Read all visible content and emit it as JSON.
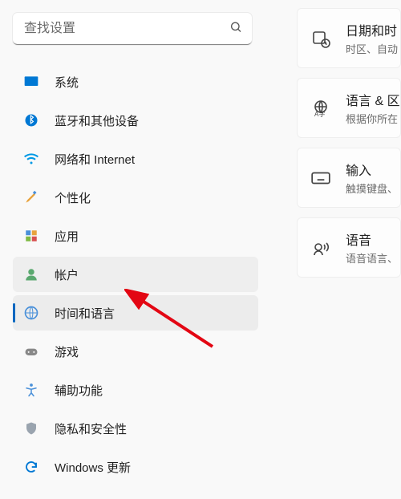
{
  "search": {
    "placeholder": "查找设置"
  },
  "sidebar": {
    "items": [
      {
        "label": "系统"
      },
      {
        "label": "蓝牙和其他设备"
      },
      {
        "label": "网络和 Internet"
      },
      {
        "label": "个性化"
      },
      {
        "label": "应用"
      },
      {
        "label": "帐户"
      },
      {
        "label": "时间和语言"
      },
      {
        "label": "游戏"
      },
      {
        "label": "辅助功能"
      },
      {
        "label": "隐私和安全性"
      },
      {
        "label": "Windows 更新"
      }
    ]
  },
  "cards": [
    {
      "title": "日期和时",
      "subtitle": "时区、自动"
    },
    {
      "title": "语言 & 区",
      "subtitle": "根据你所在"
    },
    {
      "title": "输入",
      "subtitle": "触摸键盘、"
    },
    {
      "title": "语音",
      "subtitle": "语音语言、"
    }
  ]
}
